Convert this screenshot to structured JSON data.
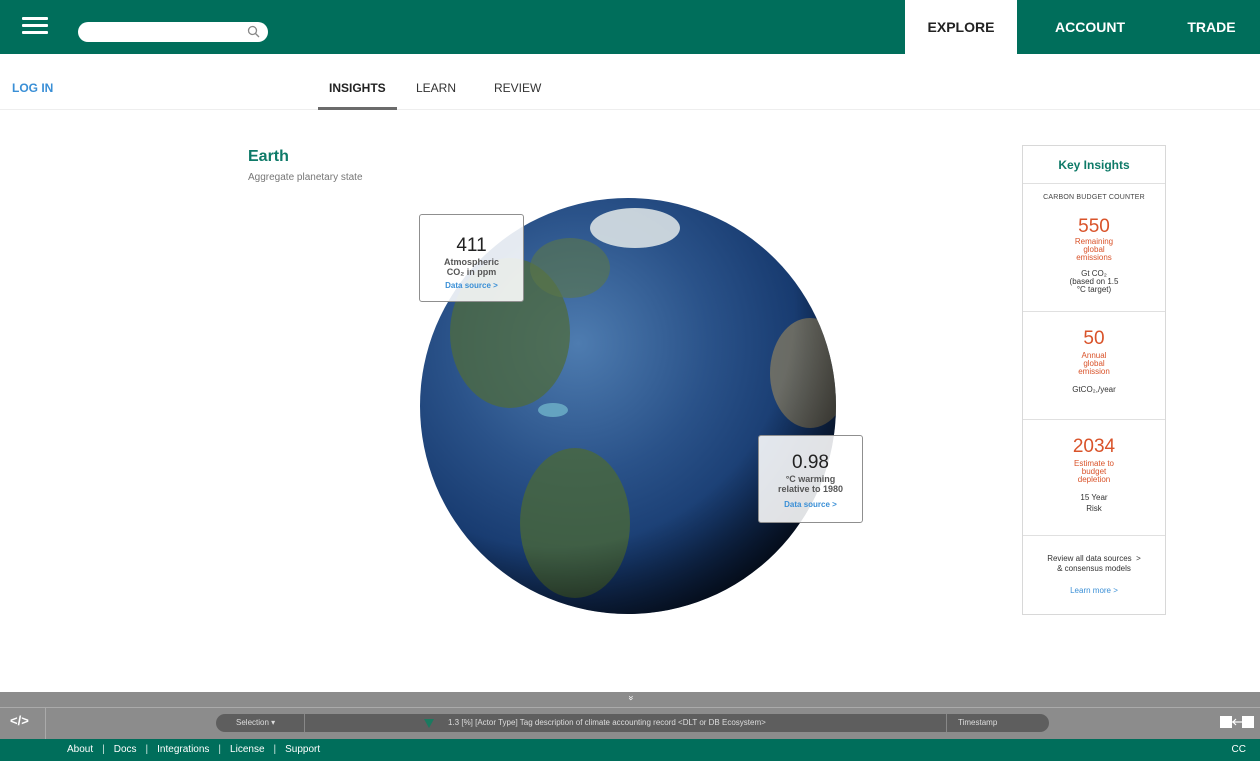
{
  "header": {
    "search_placeholder": "",
    "nav": [
      "EXPLORE",
      "ACCOUNT",
      "TRADE"
    ],
    "active_nav": "EXPLORE"
  },
  "subnav": {
    "login": "LOG IN",
    "tabs": [
      "INSIGHTS",
      "LEARN",
      "REVIEW"
    ],
    "active_tab": "INSIGHTS"
  },
  "page": {
    "title": "Earth",
    "subtitle": "Aggregate planetary state"
  },
  "callouts": {
    "co2": {
      "value": "411",
      "label_line1": "Atmospheric",
      "label_line2": "CO₂ in ppm",
      "link": "Data source >"
    },
    "warming": {
      "value": "0.98",
      "label_line1": "°C warming",
      "label_line2": "relative to 1980",
      "link": "Data source >"
    }
  },
  "key_insights": {
    "title": "Key Insights",
    "counter_label": "CARBON BUDGET COUNTER",
    "budget": {
      "value": "550",
      "line1": "Remaining",
      "line2": "global",
      "line3": "emissions",
      "unit1": "Gt CO₂",
      "unit2": "(based on 1.5",
      "unit3": "°C target)"
    },
    "annual": {
      "value": "50",
      "line1": "Annual",
      "line2": "global",
      "line3": "emission",
      "unit": "GtCO₂,/year"
    },
    "depletion": {
      "value": "2034",
      "line1": "Estimate to",
      "line2": "budget",
      "line3": "depletion",
      "unit1": "15 Year",
      "unit2": "Risk"
    },
    "review_line1": "Review all data sources",
    "review_line2": "& consensus models",
    "learn_more": "Learn more >"
  },
  "devbar": {
    "code_label": "</>",
    "selection": "Selection ▾",
    "record_text": "1.3 [%] [Actor Type] Tag description of climate accounting record  <DLT or DB Ecosystem>",
    "timestamp": "Timestamp",
    "expand_icon": "»"
  },
  "footer": {
    "links": [
      "About",
      "Docs",
      "Integrations",
      "License",
      "Support"
    ],
    "cc": "CC"
  },
  "colors": {
    "brand": "#006e5b",
    "accent_text": "#0e7a68",
    "link": "#3a8fd6",
    "warning": "#d9532a"
  }
}
